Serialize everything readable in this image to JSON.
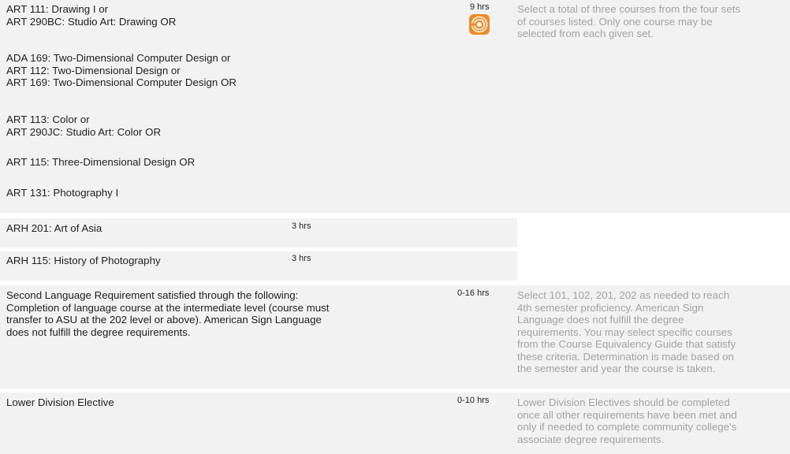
{
  "block1": {
    "groups": [
      "ART 111: Drawing I or\nART 290BC: Studio Art: Drawing OR",
      "ADA 169: Two-Dimensional Computer Design or\nART 112: Two-Dimensional Design or\nART 169: Two-Dimensional Computer Design OR",
      "ART 113: Color or\nART 290JC: Studio Art: Color OR",
      "ART 115: Three-Dimensional Design OR",
      "ART 131: Photography I"
    ],
    "hours": "9 hrs",
    "icon": "radio-waves-icon",
    "note": "Select a total of three courses from the four sets\nof courses listed. Only one course may be\nselected from each given set."
  },
  "block2": {
    "course": "ARH 201: Art of Asia",
    "hours": "3 hrs"
  },
  "block3": {
    "course": "ARH 115: History of Photography",
    "hours": "3 hrs"
  },
  "block4": {
    "course": "Second Language Requirement satisfied through the following:\nCompletion of language course at the intermediate level (course must\ntransfer to ASU at the 202 level or above). American Sign Language\ndoes not fulfill the degree requirements.",
    "hours": "0-16 hrs",
    "note": "Select 101, 102, 201, 202 as needed to reach\n4th semester proficiency. American Sign\nLanguage does not fulfill the degree\nrequirements. You may select specific courses\nfrom the Course Equivalency Guide that satisfy\nthese criteria. Determination is made based on\nthe semester and year the course is taken."
  },
  "block5": {
    "course": "Lower Division Elective",
    "hours": "0-10 hrs",
    "note": "Lower Division Electives should be completed\nonce all other requirements have been met and\nonly if needed to complete community college's\nassociate degree requirements."
  },
  "colors": {
    "row_bg": "#f2f2f2",
    "note_text": "#a3a3a3",
    "icon_orange": "#f08a24"
  }
}
